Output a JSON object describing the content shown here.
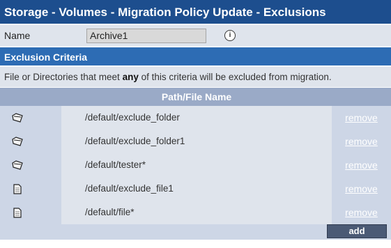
{
  "title": "Storage - Volumes - Migration Policy Update - Exclusions",
  "name_field": {
    "label": "Name",
    "value": "Archive1"
  },
  "section": {
    "title": "Exclusion Criteria"
  },
  "description": {
    "before": "File or Directories that meet ",
    "emphasis": "any",
    "after": " of this criteria will be excluded from migration."
  },
  "table": {
    "column_header": "Path/File Name",
    "rows": [
      {
        "type": "folder",
        "icon": "folder-icon",
        "path": "/default/exclude_folder",
        "action": "remove"
      },
      {
        "type": "folder",
        "icon": "folder-icon",
        "path": "/default/exclude_folder1",
        "action": "remove"
      },
      {
        "type": "folder",
        "icon": "folder-icon",
        "path": "/default/tester*",
        "action": "remove"
      },
      {
        "type": "file",
        "icon": "file-icon",
        "path": "/default/exclude_file1",
        "action": "remove"
      },
      {
        "type": "file",
        "icon": "file-icon",
        "path": "/default/file*",
        "action": "remove"
      }
    ]
  },
  "add_button": {
    "label": "add"
  },
  "colors": {
    "title_bar": "#1d4e8e",
    "section_header": "#2d6cb4",
    "table_header": "#9aaac7",
    "row_bg": "#cdd6e6",
    "light_bg": "#dfe4ec",
    "button": "#4b5a75"
  }
}
